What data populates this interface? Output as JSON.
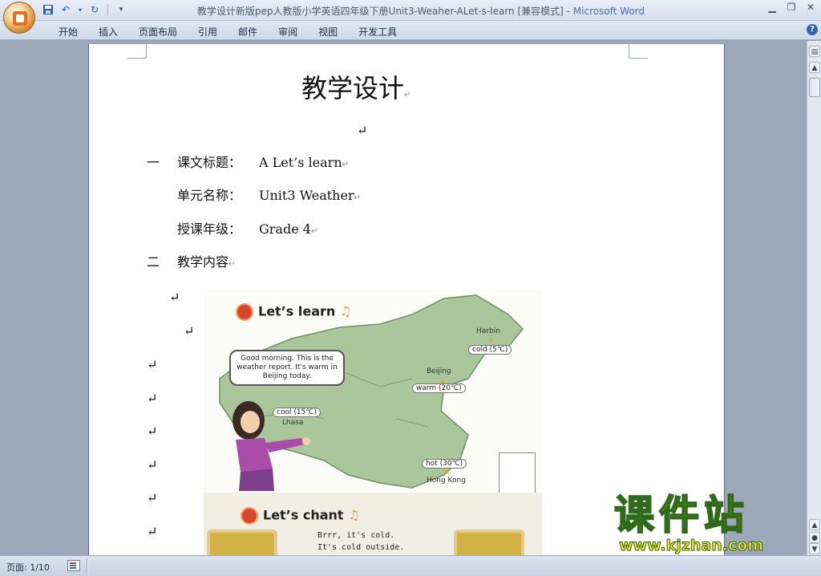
{
  "window": {
    "title": "教学设计新版pep人教版小学英语四年级下册Unit3-Weaher-ALet-s-learn [兼容模式] - ",
    "app_name": "Microsoft Word"
  },
  "ribbon": {
    "tabs": [
      "开始",
      "插入",
      "页面布局",
      "引用",
      "邮件",
      "审阅",
      "视图",
      "开发工具"
    ]
  },
  "document": {
    "title": "教学设计",
    "sections": [
      {
        "num": "一",
        "label": "课文标题：",
        "value": "A    Let’s learn"
      },
      {
        "num": "",
        "label": "单元名称：",
        "value": "Unit3    Weather"
      },
      {
        "num": "",
        "label": "授课年级：",
        "value": "Grade 4"
      },
      {
        "num": "二",
        "label": "教学内容",
        "value": ""
      }
    ],
    "paragraph_mark": "↵"
  },
  "image": {
    "lets_learn": "Let’s learn",
    "bubble": "Good morning. This is the weather report. It's warm in Beijing today.",
    "cities": [
      {
        "name": "Harbin",
        "tag": "cold (5℃)"
      },
      {
        "name": "Beijing",
        "tag": "warm (20℃)"
      },
      {
        "name": "Lhasa",
        "tag": "cool (15℃)"
      },
      {
        "name": "Hong Kong",
        "tag": "hot (30℃)"
      }
    ],
    "lets_chant": "Let’s chant",
    "chant_lines": [
      "Brrr, it's cold.",
      "It's cold outside."
    ]
  },
  "watermark": {
    "cn": "课件站",
    "url": "www.kjzhan.com"
  },
  "statusbar": {
    "page": "页面: 1/10"
  },
  "colors": {
    "accent": "#3f6fb3",
    "map_land": "#a9c79a",
    "watermark_fill": "#f6e21e"
  }
}
